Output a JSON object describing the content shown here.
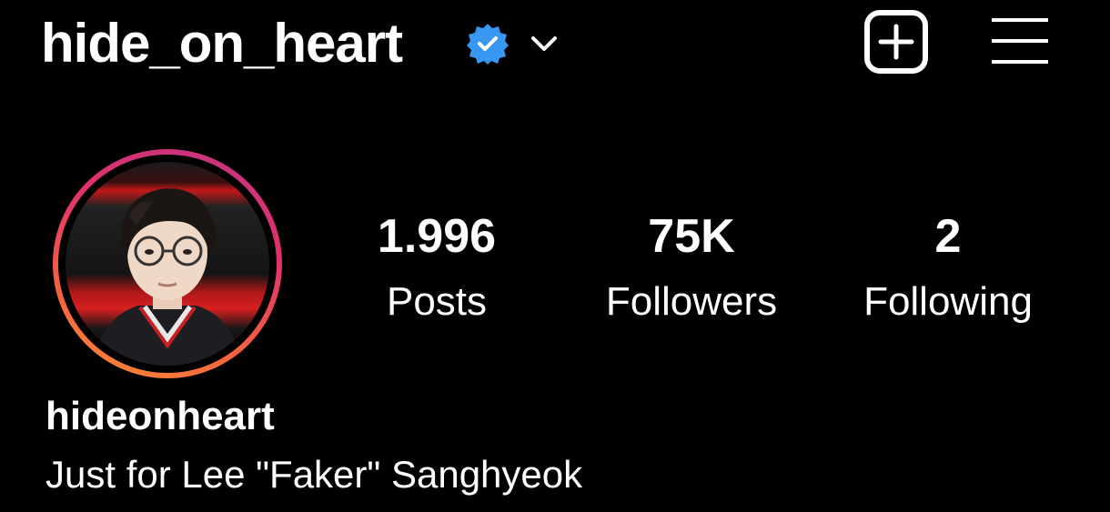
{
  "header": {
    "username": "hide_on_heart",
    "verified_icon": "verified-badge-icon",
    "dropdown_icon": "chevron-down-icon",
    "add_icon": "plus-square-icon",
    "menu_icon": "hamburger-menu-icon"
  },
  "profile": {
    "avatar_icon": "profile-picture",
    "stats": [
      {
        "value": "1.996",
        "label": "Posts"
      },
      {
        "value": "75K",
        "label": "Followers"
      },
      {
        "value": "2",
        "label": "Following"
      }
    ],
    "display_name": "hideonheart",
    "bio": "Just for Lee \"Faker\" Sanghyeok"
  },
  "colors": {
    "background": "#000000",
    "text": "#ffffff",
    "verified": "#3897f0",
    "ring_start": "#c13584",
    "ring_end": "#fd8d32"
  }
}
